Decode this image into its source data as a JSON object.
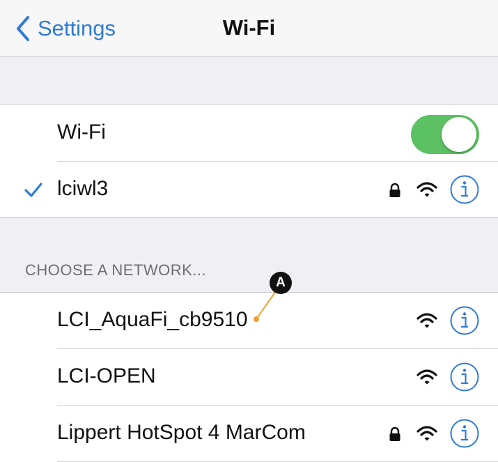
{
  "navbar": {
    "back_label": "Settings",
    "title": "Wi-Fi"
  },
  "wifi_toggle": {
    "label": "Wi-Fi",
    "enabled": true,
    "color": "#5cc163"
  },
  "connected_network": {
    "name": "lciwl3",
    "secured": true,
    "icons": [
      "checkmark-icon",
      "lock-icon",
      "wifi-signal-icon",
      "info-icon"
    ]
  },
  "section_header": "CHOOSE A NETWORK...",
  "networks": [
    {
      "name": "LCI_AquaFi_cb9510",
      "secured": false
    },
    {
      "name": "LCI-OPEN",
      "secured": false
    },
    {
      "name": "Lippert HotSpot 4 MarCom",
      "secured": true
    }
  ],
  "callout": {
    "letter": "A",
    "color": "#f0a030"
  },
  "colors": {
    "accent": "#2f7bd6",
    "group_background": "#efeff4",
    "separator": "#d1d1d6"
  }
}
